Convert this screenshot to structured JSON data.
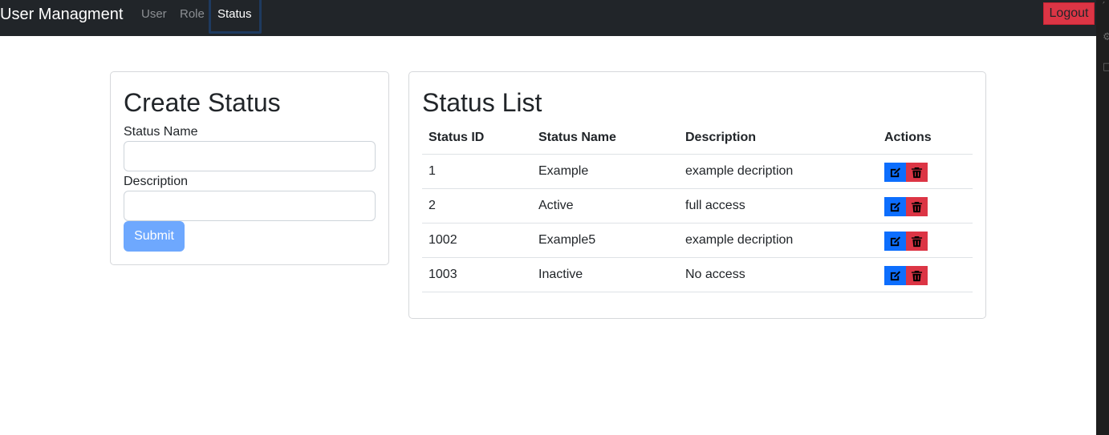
{
  "navbar": {
    "brand": "User Managment",
    "links": [
      {
        "label": "User"
      },
      {
        "label": "Role"
      },
      {
        "label": "Status"
      }
    ],
    "logout_label": "Logout"
  },
  "create_card": {
    "title": "Create Status",
    "status_name_label": "Status Name",
    "status_name_value": "",
    "description_label": "Description",
    "description_value": "",
    "submit_label": "Submit"
  },
  "list_card": {
    "title": "Status List",
    "columns": [
      "Status ID",
      "Status Name",
      "Description",
      "Actions"
    ],
    "rows": [
      {
        "id": "1",
        "name": "Example",
        "description": "example decription"
      },
      {
        "id": "2",
        "name": "Active",
        "description": "full access"
      },
      {
        "id": "1002",
        "name": "Example5",
        "description": "example decription"
      },
      {
        "id": "1003",
        "name": "Inactive",
        "description": "No access"
      }
    ],
    "row_actions": [
      "edit-icon",
      "trash-icon"
    ]
  },
  "colors": {
    "navbar_bg": "#212529",
    "edit_button": "#0d6efd",
    "delete_button": "#dc3545",
    "submit_button": "#6ea8fe",
    "logout_button": "#dc3545"
  }
}
